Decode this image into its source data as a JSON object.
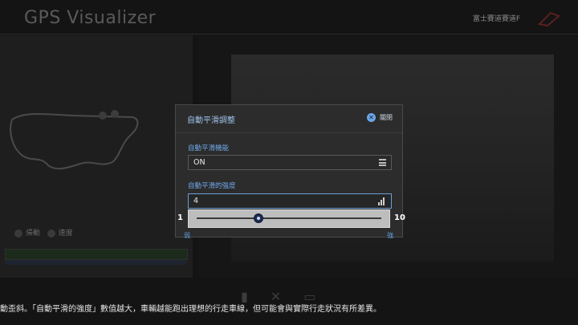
{
  "background": {
    "app_title": "GPS Visualizer",
    "course_name": "富士賽道賽道F",
    "legend": [
      "帰動",
      "速度"
    ],
    "bottom_hint": "動歪斜。「自動平滑的強度」數值越大，車輛越能跑出理想的行走車線，但可能會與實際行走狀況有所差異。"
  },
  "dialog": {
    "title": "自動平滑調整",
    "close_label": "關閉",
    "close_icon": "close-circle-icon",
    "function_field": {
      "label": "自動平滑機能",
      "value": "ON",
      "icon": "list-icon"
    },
    "strength_field": {
      "label": "自動平滑的強度",
      "value": "4",
      "icon": "signal-level-icon"
    },
    "slider": {
      "min": 1,
      "max": 10,
      "value": 4,
      "min_label": "弱",
      "max_label": "強",
      "min_number": "1",
      "max_number": "10"
    }
  },
  "colors": {
    "accent": "#6aa6e8",
    "dialog_bg": "#2c2c2c",
    "slider_bg": "#bdbdbd",
    "thumb": "#1d2b52"
  }
}
